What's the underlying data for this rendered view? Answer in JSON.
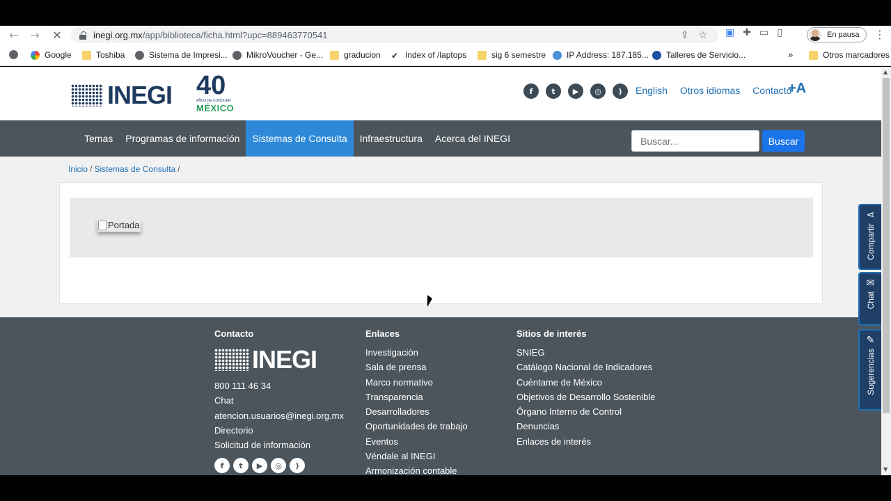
{
  "browser": {
    "url_host": "inegi.org.mx",
    "url_path": "/app/biblioteca/ficha.html?upc=889463770541",
    "profile_label": "En pausa",
    "bookmarks": [
      {
        "label": "Google",
        "icon": "google-icon"
      },
      {
        "label": "Toshiba",
        "icon": "folder-icon"
      },
      {
        "label": "Sistema de Impresi...",
        "icon": "globe-icon"
      },
      {
        "label": "MikroVoucher - Ge...",
        "icon": "globe-icon"
      },
      {
        "label": "graducion",
        "icon": "folder-icon"
      },
      {
        "label": "Index of /laptops",
        "icon": "bookmark-icon"
      },
      {
        "label": "sig 6 semestre",
        "icon": "folder-icon"
      },
      {
        "label": "IP Address: 187.185...",
        "icon": "globe-icon"
      },
      {
        "label": "Talleres de Servicio...",
        "icon": "ge-icon"
      }
    ],
    "more_bookmarks": "»",
    "other_bookmarks": "Otros marcadores"
  },
  "header": {
    "logo_text": "INEGI",
    "anniversary_number": "40",
    "anniversary_small": "AÑOS DE CONOCER",
    "anniversary_country": "MÉXICO",
    "social": [
      "facebook-icon",
      "twitter-icon",
      "youtube-icon",
      "instagram-icon",
      "rss-icon"
    ],
    "links": [
      "English",
      "Otros idiomas",
      "Contacto"
    ],
    "font_size_button": "+A"
  },
  "nav": {
    "items": [
      "Temas",
      "Programas de información",
      "Sistemas de Consulta",
      "Infraestructura",
      "Acerca del INEGI"
    ],
    "active_index": 2,
    "search_placeholder": "Buscar...",
    "search_button": "Buscar"
  },
  "breadcrumb": [
    "Inicio",
    "Sistemas de Consulta"
  ],
  "content": {
    "image_alt": "Portada"
  },
  "footer": {
    "contact": {
      "heading": "Contacto",
      "logo_text": "INEGI",
      "items": [
        "800 111 46 34",
        "Chat",
        "atencion.usuarios@inegi.org.mx",
        "Directorio",
        "Solicitud de información"
      ]
    },
    "links": {
      "heading": "Enlaces",
      "items": [
        "Investigación",
        "Sala de prensa",
        "Marco normativo",
        "Transparencia",
        "Desarrolladores",
        "Oportunidades de trabajo",
        "Eventos",
        "Véndale al INEGI",
        "Armonización contable"
      ]
    },
    "sites": {
      "heading": "Sitios de interés",
      "items": [
        "SNIEG",
        "Catálogo Nacional de Indicadores",
        "Cuéntame de México",
        "Objetivos de Desarrollo Sostenible",
        "Órgano Interno de Control",
        "Denuncias",
        "Enlaces de interés"
      ]
    }
  },
  "side_tabs": [
    "Compartir",
    "Chat",
    "Sugerencias"
  ],
  "colors": {
    "nav_bg": "#4c555c",
    "active_nav": "#2e8ad8",
    "link_blue": "#1f6fb3",
    "search_button": "#1a73e8",
    "brand_navy": "#1e3a5f",
    "brand_green": "#2aa05a"
  }
}
